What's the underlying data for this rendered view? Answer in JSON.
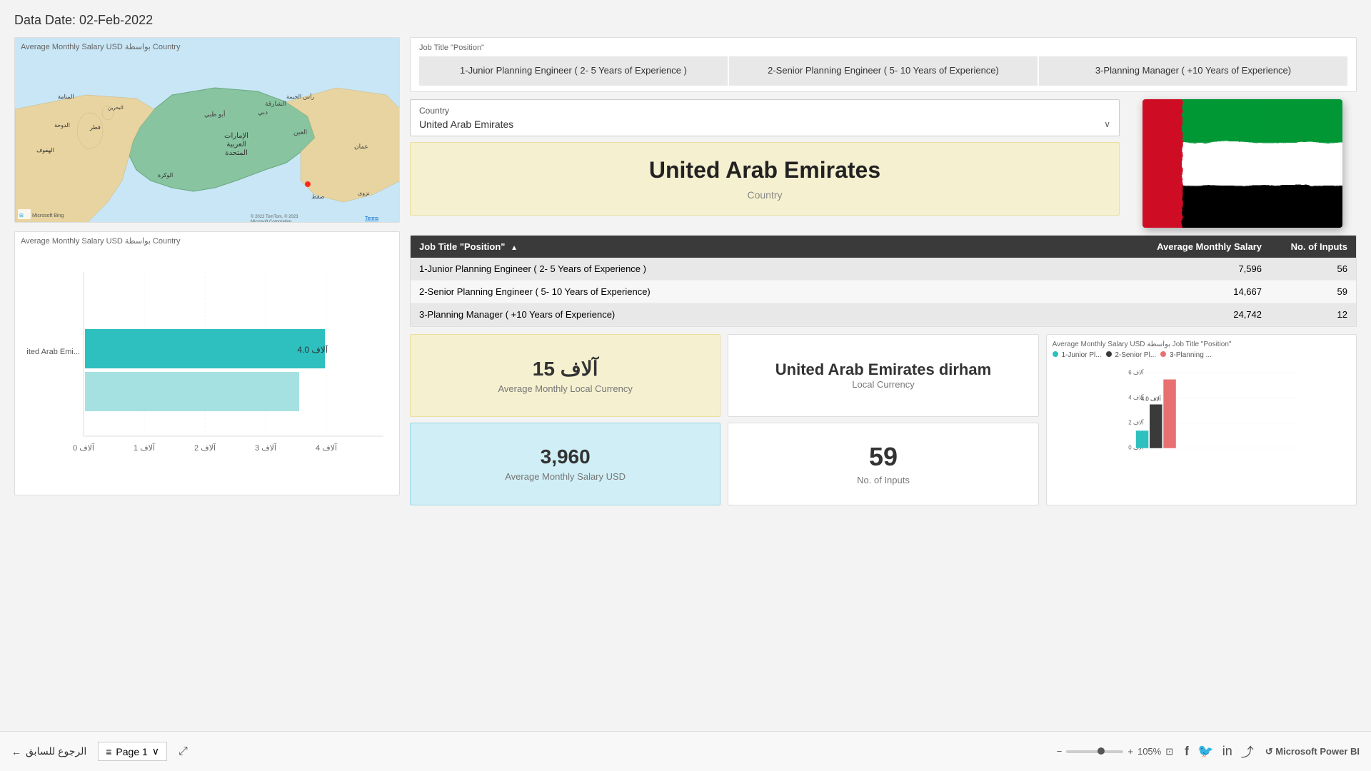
{
  "header": {
    "data_date_label": "Data Date: 02-Feb-2022"
  },
  "job_filter": {
    "label": "Job Title \"Position\"",
    "buttons": [
      "1-Junior Planning Engineer ( 2- 5 Years of Experience )",
      "2-Senior Planning Engineer ( 5- 10 Years of Experience)",
      "3-Planning Manager ( +10 Years of Experience)"
    ]
  },
  "country_dropdown": {
    "label": "Country",
    "selected": "United Arab Emirates",
    "chevron": "∨"
  },
  "country_display": {
    "name": "United Arab Emirates",
    "sublabel": "Country"
  },
  "map": {
    "title": "Average Monthly Salary USD بواسطة Country"
  },
  "bar_chart": {
    "title": "Average Monthly Salary USD بواسطة Country",
    "bar_label": "United Arab Emi...",
    "bar_value": "آلاف 4.0",
    "x_labels": [
      "آلاف 0",
      "آلاف 1",
      "آلاف 2",
      "آلاف 3",
      "آلاف 4"
    ]
  },
  "salary_table": {
    "headers": [
      "Job Title \"Position\"",
      "Average Monthly Salary",
      "No. of Inputs"
    ],
    "sort_indicator": "▲",
    "rows": [
      {
        "title": "1-Junior Planning Engineer ( 2- 5 Years of Experience )",
        "avg_salary": "7,596",
        "inputs": "56"
      },
      {
        "title": "2-Senior Planning Engineer ( 5- 10 Years of Experience)",
        "avg_salary": "14,667",
        "inputs": "59"
      },
      {
        "title": "3-Planning Manager ( +10 Years of Experience)",
        "avg_salary": "24,742",
        "inputs": "12"
      }
    ]
  },
  "stats": {
    "avg_local_currency_value": "آلاف 15",
    "avg_local_currency_label": "Average Monthly Local Currency",
    "local_currency_name": "United Arab Emirates dirham",
    "local_currency_sublabel": "Local Currency",
    "avg_usd_value": "3,960",
    "avg_usd_label": "Average Monthly Salary USD",
    "no_inputs_value": "59",
    "no_inputs_label": "No. of Inputs"
  },
  "mini_chart": {
    "title": "Average Monthly Salary USD بواسطة Job Title \"Position\"",
    "legend": [
      {
        "label": "1-Junior Pl...",
        "color": "#2ebfbf"
      },
      {
        "label": "2-Senior Pl...",
        "color": "#3a3a3a"
      },
      {
        "label": "3-Planning ...",
        "color": "#e87070"
      }
    ],
    "y_labels": [
      "آلاف 6",
      "آلاف 4",
      "آلاف 2",
      "آلاف 0"
    ],
    "bar_annotation": "آلاف 4.0"
  },
  "footer": {
    "back_label": "الرجوع للسابق",
    "page_label": "Page 1",
    "zoom_label": "105%"
  }
}
